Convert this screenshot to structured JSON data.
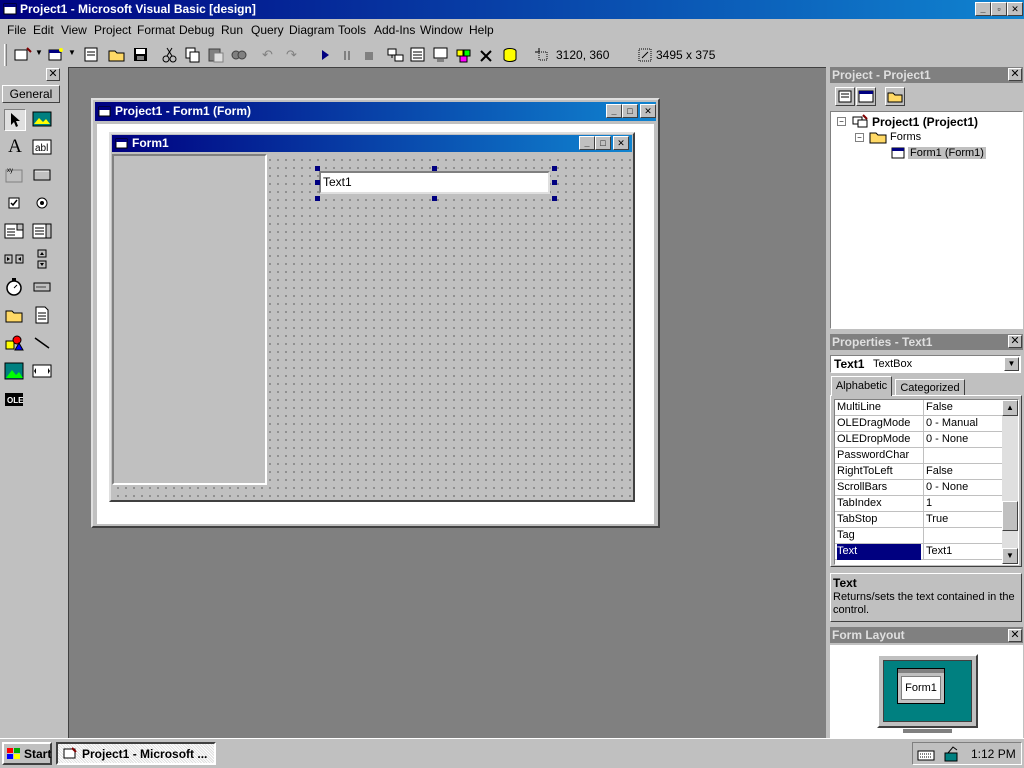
{
  "window": {
    "title": "Project1 - Microsoft Visual Basic [design]"
  },
  "menu": [
    "File",
    "Edit",
    "View",
    "Project",
    "Format",
    "Debug",
    "Run",
    "Query",
    "Diagram",
    "Tools",
    "Add-Ins",
    "Window",
    "Help"
  ],
  "toolbar": {
    "position_readout": "3120, 360",
    "size_readout": "3495 x 375"
  },
  "toolbox": {
    "tab_label": "General"
  },
  "designer": {
    "title": "Project1 - Form1 (Form)",
    "form_caption": "Form1",
    "textbox_text": "Text1"
  },
  "project_explorer": {
    "title": "Project - Project1",
    "root": "Project1 (Project1)",
    "folder": "Forms",
    "item": "Form1 (Form1)"
  },
  "properties": {
    "title": "Properties - Text1",
    "object_name": "Text1",
    "object_type": "TextBox",
    "tabs": [
      "Alphabetic",
      "Categorized"
    ],
    "rows": [
      {
        "name": "MultiLine",
        "value": "False"
      },
      {
        "name": "OLEDragMode",
        "value": "0 - Manual"
      },
      {
        "name": "OLEDropMode",
        "value": "0 - None"
      },
      {
        "name": "PasswordChar",
        "value": ""
      },
      {
        "name": "RightToLeft",
        "value": "False"
      },
      {
        "name": "ScrollBars",
        "value": "0 - None"
      },
      {
        "name": "TabIndex",
        "value": "1"
      },
      {
        "name": "TabStop",
        "value": "True"
      },
      {
        "name": "Tag",
        "value": ""
      },
      {
        "name": "Text",
        "value": "Text1",
        "selected": true
      }
    ],
    "desc_title": "Text",
    "desc_text": "Returns/sets the text contained in the control."
  },
  "form_layout": {
    "title": "Form Layout",
    "thumbnail_label": "Form1"
  },
  "taskbar": {
    "start_label": "Start",
    "task_label": "Project1 - Microsoft ...",
    "clock": "1:12 PM"
  },
  "colors": {
    "title_active": "#000080",
    "title_inactive": "#808080",
    "selection": "#000080",
    "form_layout_screen": "#008080"
  }
}
